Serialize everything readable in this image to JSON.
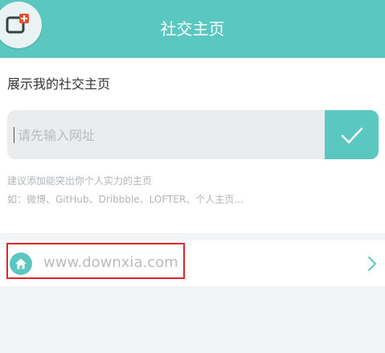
{
  "header": {
    "title": "社交主页",
    "accent": "#5ac8c0",
    "app_icon": "add-window-icon"
  },
  "section": {
    "title": "展示我的社交主页"
  },
  "input": {
    "value": "",
    "placeholder": "请先输入网址"
  },
  "confirm": {
    "icon": "checkmark-icon"
  },
  "hints": {
    "line1": "建议添加能突出你个人实力的主页",
    "line2": "如：微博、GitHub、Dribbble、LOFTER、个人主页..."
  },
  "link_row": {
    "icon": "home-icon",
    "url": "www.downxia.com",
    "chevron": "chevron-right-icon",
    "highlight_color": "#e0262d"
  }
}
